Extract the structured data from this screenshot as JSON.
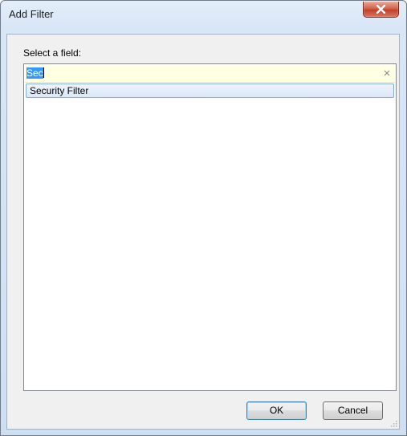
{
  "window": {
    "title": "Add Filter",
    "close_icon": "close-x-icon",
    "close_color": "#c7432b"
  },
  "form": {
    "field_label": "Select a field:"
  },
  "search": {
    "value": "Sec",
    "selected": true,
    "clear_icon": "clear-x-icon",
    "background": "#ffffe1"
  },
  "results": [
    {
      "label": "Security Filter",
      "highlighted": true
    }
  ],
  "buttons": {
    "ok_label": "OK",
    "cancel_label": "Cancel"
  }
}
